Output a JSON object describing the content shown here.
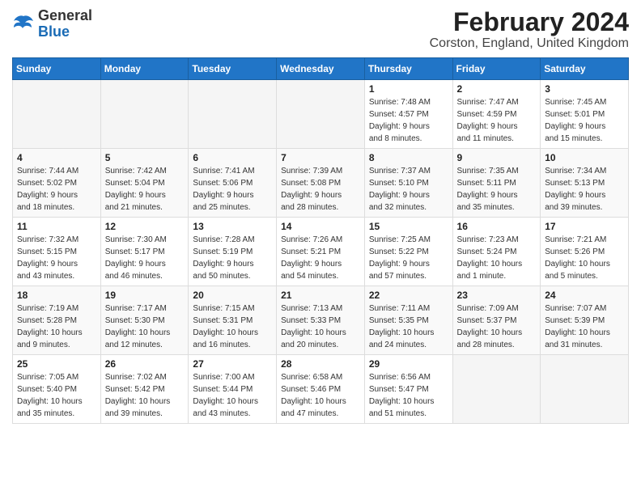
{
  "logo": {
    "general": "General",
    "blue": "Blue"
  },
  "header": {
    "month_year": "February 2024",
    "location": "Corston, England, United Kingdom"
  },
  "days_of_week": [
    "Sunday",
    "Monday",
    "Tuesday",
    "Wednesday",
    "Thursday",
    "Friday",
    "Saturday"
  ],
  "weeks": [
    [
      {
        "day": "",
        "info": ""
      },
      {
        "day": "",
        "info": ""
      },
      {
        "day": "",
        "info": ""
      },
      {
        "day": "",
        "info": ""
      },
      {
        "day": "1",
        "info": "Sunrise: 7:48 AM\nSunset: 4:57 PM\nDaylight: 9 hours\nand 8 minutes."
      },
      {
        "day": "2",
        "info": "Sunrise: 7:47 AM\nSunset: 4:59 PM\nDaylight: 9 hours\nand 11 minutes."
      },
      {
        "day": "3",
        "info": "Sunrise: 7:45 AM\nSunset: 5:01 PM\nDaylight: 9 hours\nand 15 minutes."
      }
    ],
    [
      {
        "day": "4",
        "info": "Sunrise: 7:44 AM\nSunset: 5:02 PM\nDaylight: 9 hours\nand 18 minutes."
      },
      {
        "day": "5",
        "info": "Sunrise: 7:42 AM\nSunset: 5:04 PM\nDaylight: 9 hours\nand 21 minutes."
      },
      {
        "day": "6",
        "info": "Sunrise: 7:41 AM\nSunset: 5:06 PM\nDaylight: 9 hours\nand 25 minutes."
      },
      {
        "day": "7",
        "info": "Sunrise: 7:39 AM\nSunset: 5:08 PM\nDaylight: 9 hours\nand 28 minutes."
      },
      {
        "day": "8",
        "info": "Sunrise: 7:37 AM\nSunset: 5:10 PM\nDaylight: 9 hours\nand 32 minutes."
      },
      {
        "day": "9",
        "info": "Sunrise: 7:35 AM\nSunset: 5:11 PM\nDaylight: 9 hours\nand 35 minutes."
      },
      {
        "day": "10",
        "info": "Sunrise: 7:34 AM\nSunset: 5:13 PM\nDaylight: 9 hours\nand 39 minutes."
      }
    ],
    [
      {
        "day": "11",
        "info": "Sunrise: 7:32 AM\nSunset: 5:15 PM\nDaylight: 9 hours\nand 43 minutes."
      },
      {
        "day": "12",
        "info": "Sunrise: 7:30 AM\nSunset: 5:17 PM\nDaylight: 9 hours\nand 46 minutes."
      },
      {
        "day": "13",
        "info": "Sunrise: 7:28 AM\nSunset: 5:19 PM\nDaylight: 9 hours\nand 50 minutes."
      },
      {
        "day": "14",
        "info": "Sunrise: 7:26 AM\nSunset: 5:21 PM\nDaylight: 9 hours\nand 54 minutes."
      },
      {
        "day": "15",
        "info": "Sunrise: 7:25 AM\nSunset: 5:22 PM\nDaylight: 9 hours\nand 57 minutes."
      },
      {
        "day": "16",
        "info": "Sunrise: 7:23 AM\nSunset: 5:24 PM\nDaylight: 10 hours\nand 1 minute."
      },
      {
        "day": "17",
        "info": "Sunrise: 7:21 AM\nSunset: 5:26 PM\nDaylight: 10 hours\nand 5 minutes."
      }
    ],
    [
      {
        "day": "18",
        "info": "Sunrise: 7:19 AM\nSunset: 5:28 PM\nDaylight: 10 hours\nand 9 minutes."
      },
      {
        "day": "19",
        "info": "Sunrise: 7:17 AM\nSunset: 5:30 PM\nDaylight: 10 hours\nand 12 minutes."
      },
      {
        "day": "20",
        "info": "Sunrise: 7:15 AM\nSunset: 5:31 PM\nDaylight: 10 hours\nand 16 minutes."
      },
      {
        "day": "21",
        "info": "Sunrise: 7:13 AM\nSunset: 5:33 PM\nDaylight: 10 hours\nand 20 minutes."
      },
      {
        "day": "22",
        "info": "Sunrise: 7:11 AM\nSunset: 5:35 PM\nDaylight: 10 hours\nand 24 minutes."
      },
      {
        "day": "23",
        "info": "Sunrise: 7:09 AM\nSunset: 5:37 PM\nDaylight: 10 hours\nand 28 minutes."
      },
      {
        "day": "24",
        "info": "Sunrise: 7:07 AM\nSunset: 5:39 PM\nDaylight: 10 hours\nand 31 minutes."
      }
    ],
    [
      {
        "day": "25",
        "info": "Sunrise: 7:05 AM\nSunset: 5:40 PM\nDaylight: 10 hours\nand 35 minutes."
      },
      {
        "day": "26",
        "info": "Sunrise: 7:02 AM\nSunset: 5:42 PM\nDaylight: 10 hours\nand 39 minutes."
      },
      {
        "day": "27",
        "info": "Sunrise: 7:00 AM\nSunset: 5:44 PM\nDaylight: 10 hours\nand 43 minutes."
      },
      {
        "day": "28",
        "info": "Sunrise: 6:58 AM\nSunset: 5:46 PM\nDaylight: 10 hours\nand 47 minutes."
      },
      {
        "day": "29",
        "info": "Sunrise: 6:56 AM\nSunset: 5:47 PM\nDaylight: 10 hours\nand 51 minutes."
      },
      {
        "day": "",
        "info": ""
      },
      {
        "day": "",
        "info": ""
      }
    ]
  ]
}
